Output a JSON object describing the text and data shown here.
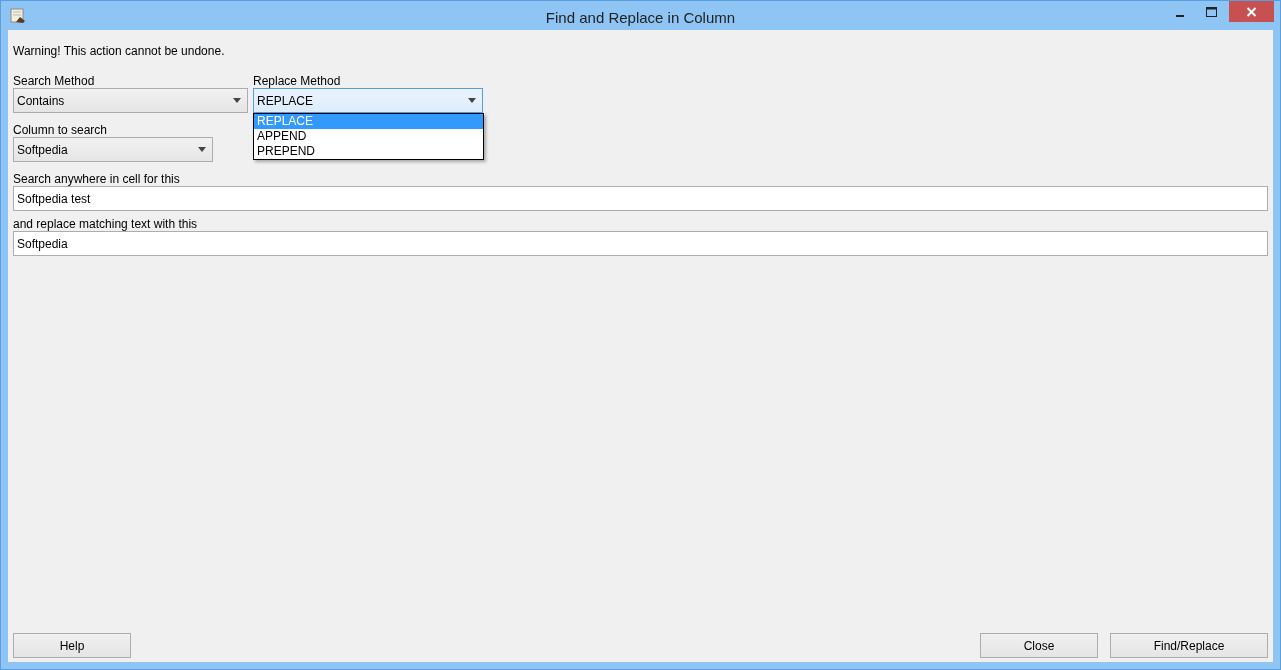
{
  "window": {
    "title": "Find and Replace in Column"
  },
  "warning": "Warning! This action cannot be undone.",
  "search_method": {
    "label": "Search Method",
    "value": "Contains",
    "expanded": false
  },
  "replace_method": {
    "label": "Replace Method",
    "value": "REPLACE",
    "expanded": true,
    "options": [
      {
        "label": "REPLACE",
        "selected": true
      },
      {
        "label": "APPEND",
        "selected": false
      },
      {
        "label": "PREPEND",
        "selected": false
      }
    ]
  },
  "column_to_search": {
    "label": "Column to search",
    "value": "Softpedia",
    "expanded": false
  },
  "search_text": {
    "label": "Search anywhere in cell for this",
    "value": "Softpedia test"
  },
  "replace_text": {
    "label": "and replace matching text with this",
    "value": "Softpedia"
  },
  "buttons_left": [
    {
      "label": "Help"
    }
  ],
  "buttons_right": [
    {
      "label": "Close"
    },
    {
      "label": "Find/Replace"
    }
  ]
}
